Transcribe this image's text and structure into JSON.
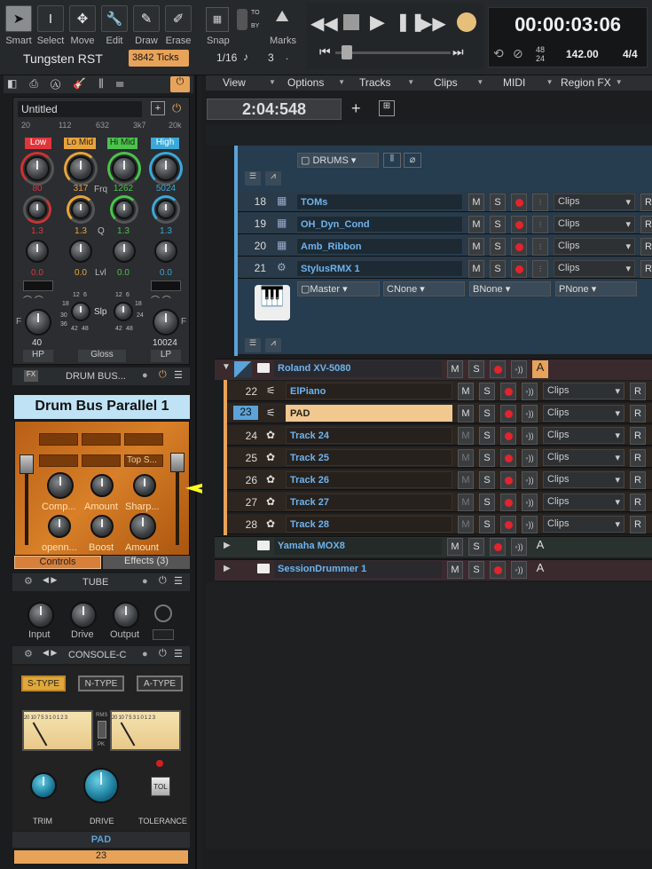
{
  "toolbar": {
    "tools": [
      {
        "label": "Smart",
        "icon": "arrow-cursor-icon"
      },
      {
        "label": "Select",
        "icon": "ibeam-icon"
      },
      {
        "label": "Move",
        "icon": "move-arrows-icon"
      },
      {
        "label": "Edit",
        "icon": "wrench-icon"
      },
      {
        "label": "Draw",
        "icon": "pencil-icon"
      },
      {
        "label": "Erase",
        "icon": "eraser-icon"
      }
    ],
    "theme": "Tungsten RST",
    "ticks": "3842 Ticks",
    "snap_label": "Snap",
    "snap_value": "1/16",
    "snap_count": "3",
    "to": "TO",
    "by": "BY",
    "marks_label": "Marks"
  },
  "transport": {
    "time": "00:00:03:06",
    "sig_top": "48",
    "sig_bottom": "24",
    "tempo": "142.00",
    "meter": "4/4"
  },
  "menu": [
    "View",
    "Options",
    "Tracks",
    "Clips",
    "MIDI",
    "Region FX"
  ],
  "position": "2:04:548",
  "folder_top": {
    "drums": "DRUMS"
  },
  "tracks_blue": [
    {
      "num": "18",
      "name": "TOMs",
      "clips": "Clips"
    },
    {
      "num": "19",
      "name": "OH_Dyn_Cond",
      "clips": "Clips"
    },
    {
      "num": "20",
      "name": "Amb_Ribbon",
      "clips": "Clips"
    },
    {
      "num": "21",
      "name": "StylusRMX 1",
      "clips": "Clips"
    }
  ],
  "stylus_routes": {
    "out": "Master",
    "c": "None",
    "b": "None",
    "p": "None"
  },
  "folder_roland": {
    "name": "Roland XV-5080",
    "a": "A"
  },
  "tracks_orange": [
    {
      "num": "22",
      "name": "ElPiano",
      "clips": "Clips"
    },
    {
      "num": "23",
      "name": "PAD",
      "clips": "Clips"
    },
    {
      "num": "24",
      "name": "Track 24",
      "clips": "Clips"
    },
    {
      "num": "25",
      "name": "Track 25",
      "clips": "Clips"
    },
    {
      "num": "26",
      "name": "Track 26",
      "clips": "Clips"
    },
    {
      "num": "27",
      "name": "Track 27",
      "clips": "Clips"
    },
    {
      "num": "28",
      "name": "Track 28",
      "clips": "Clips"
    }
  ],
  "folders_bottom": [
    {
      "name": "Yamaha MOX8",
      "a": "A"
    },
    {
      "name": "SessionDrummer 1",
      "a": "A"
    }
  ],
  "btn": {
    "m": "M",
    "s": "S",
    "r": "R"
  },
  "eq": {
    "preset": "Untitled",
    "freq_scale": [
      "20",
      "112",
      "632",
      "3k7",
      "20k"
    ],
    "bands": [
      {
        "name": "Low",
        "color": "#e0363a",
        "freq": "80",
        "q": "1.3",
        "lvl": "0.0"
      },
      {
        "name": "Lo Mid",
        "color": "#e8a43a",
        "freq": "317",
        "q": "1.3",
        "lvl": "0.0"
      },
      {
        "name": "Hi Mid",
        "color": "#4ac44a",
        "freq": "1262",
        "q": "1.3",
        "lvl": "0.0"
      },
      {
        "name": "High",
        "color": "#3aa8d8",
        "freq": "5024",
        "q": "1.3",
        "lvl": "0.0"
      }
    ],
    "row_labels": {
      "frq": "Frq",
      "q": "Q",
      "lvl": "Lvl"
    },
    "hp": "40",
    "lp": "10024",
    "hp_label": "HP",
    "lp_label": "LP",
    "gloss": "Gloss",
    "slp": "Slp",
    "f": "F",
    "slp_ticks": [
      "12",
      "6",
      "18",
      "30",
      "24",
      "36",
      "42",
      "48"
    ]
  },
  "fx_rack": {
    "title": "DRUM BUS...",
    "plugin_name": "Drum Bus Parallel 1",
    "top_button": "Top S...",
    "knobs_row1": [
      "Comp...",
      "Amount",
      "Sharp..."
    ],
    "knobs_row2": [
      "openn...",
      "Boost",
      "Amount"
    ],
    "tabs": [
      "Controls",
      "Effects (3)"
    ]
  },
  "tube": {
    "title": "TUBE",
    "knobs": [
      "Input",
      "Drive",
      "Output"
    ]
  },
  "console": {
    "title": "CONSOLE-C",
    "types": [
      "S-TYPE",
      "N-TYPE",
      "A-TYPE"
    ],
    "vu_scale": "20 10 7 5 3 1 0 1 2 3",
    "rms": "RMS",
    "pk": "PK",
    "knobs": [
      "TRIM",
      "DRIVE",
      "TOLERANCE"
    ],
    "tol": "TOL"
  },
  "strip": {
    "name": "PAD",
    "num": "23"
  },
  "colors": {
    "accent_orange": "#e8a35a",
    "track_blue": "#5ba3d8",
    "arrow_yellow": "#ffff1f"
  }
}
